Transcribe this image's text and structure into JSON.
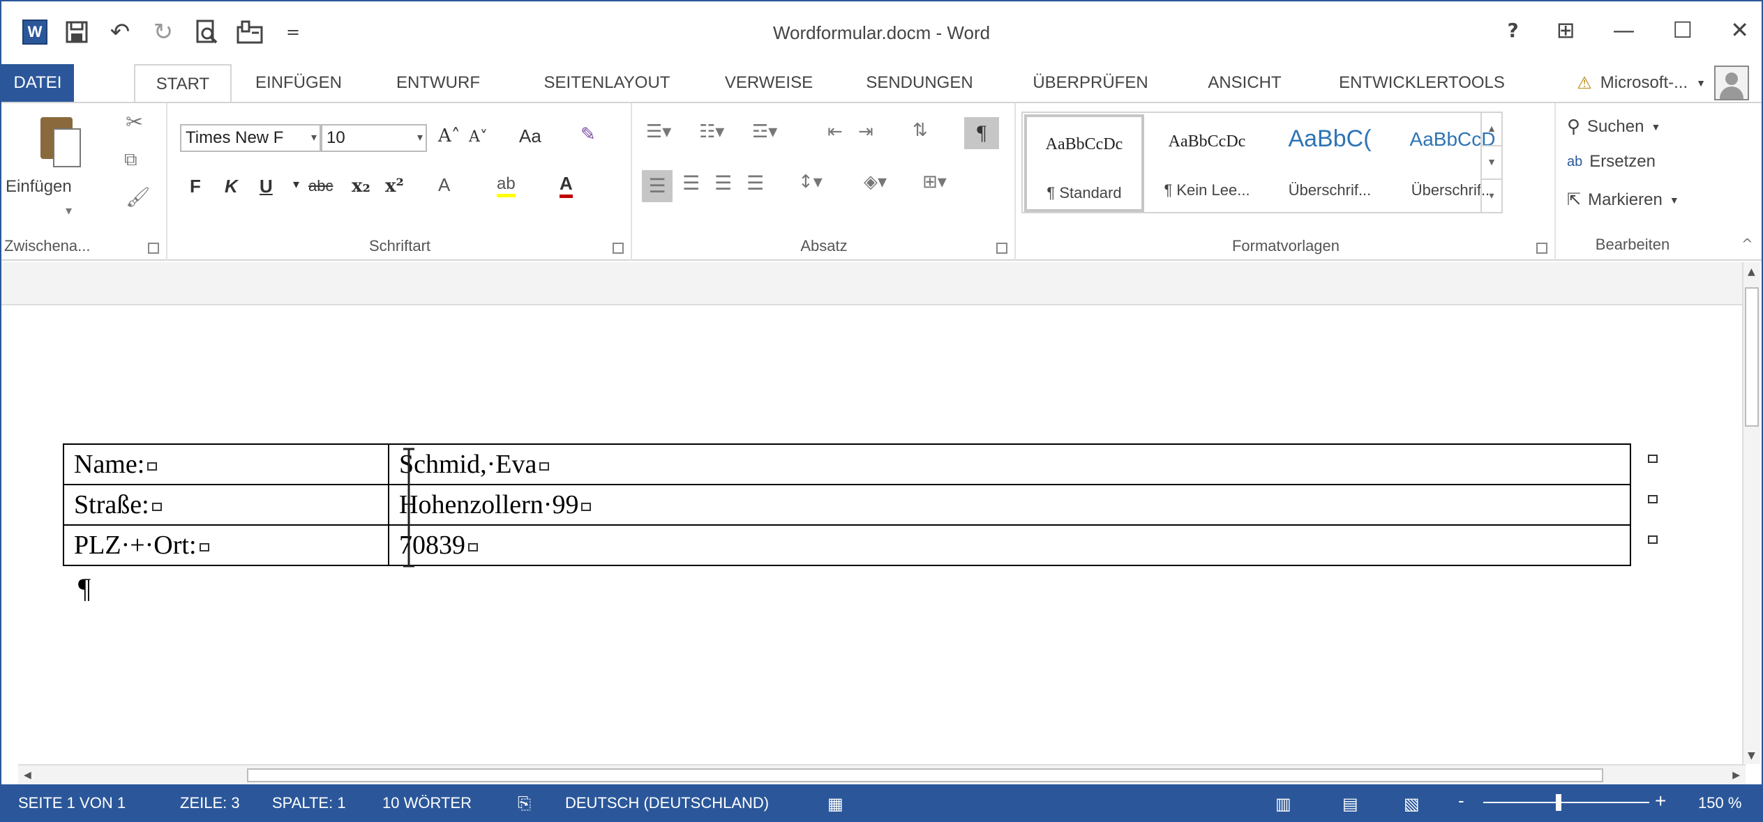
{
  "window": {
    "title": "Wordformular.docm - Word",
    "accent": "#2b579a"
  },
  "qat": {
    "word_icon": "W",
    "save_icon": "save-icon",
    "undo_icon": "undo-icon",
    "redo_icon": "redo-icon",
    "print_preview_icon": "print-preview-icon",
    "form_icon": "form-icon",
    "customize_icon": "customize-icon"
  },
  "window_buttons": {
    "help": "?",
    "ribbon_options": "⊞",
    "minimize": "—",
    "maximize": "☐",
    "close": "✕"
  },
  "tabs": [
    {
      "label": "DATEI"
    },
    {
      "label": "START"
    },
    {
      "label": "EINFÜGEN"
    },
    {
      "label": "ENTWURF"
    },
    {
      "label": "SEITENLAYOUT"
    },
    {
      "label": "VERWEISE"
    },
    {
      "label": "SENDUNGEN"
    },
    {
      "label": "ÜBERPRÜFEN"
    },
    {
      "label": "ANSICHT"
    },
    {
      "label": "ENTWICKLERTOOLS"
    }
  ],
  "account": {
    "name": "Microsoft-...",
    "warning_icon": "⚠"
  },
  "ribbon": {
    "clipboard": {
      "paste_label": "Einfügen",
      "group_label": "Zwischena..."
    },
    "font": {
      "font_name": "Times New F",
      "font_size": "10",
      "group_label": "Schriftart",
      "bold": "F",
      "italic": "K",
      "underline": "U",
      "strikethrough": "abc",
      "subscript": "x₂",
      "superscript": "x²",
      "grow": "A˄",
      "shrink": "A˅",
      "case": "Aa",
      "effects": "A",
      "highlight": "ab",
      "color": "A"
    },
    "paragraph": {
      "group_label": "Absatz",
      "show_marks": "¶"
    },
    "styles": {
      "group_label": "Formatvorlagen",
      "items": [
        {
          "sample": "AaBbCcDc",
          "name": "¶ Standard"
        },
        {
          "sample": "AaBbCcDc",
          "name": "¶ Kein Lee..."
        },
        {
          "sample": "AaBbC(",
          "name": "Überschrif..."
        },
        {
          "sample": "AaBbCcD",
          "name": "Überschrif..."
        }
      ]
    },
    "editing": {
      "group_label": "Bearbeiten",
      "find": "Suchen",
      "replace": "Ersetzen",
      "select": "Markieren"
    }
  },
  "document": {
    "rows": [
      {
        "label": "Name:",
        "value": "Schmid,·Eva"
      },
      {
        "label": "Straße:",
        "value": "Hohenzollern·99"
      },
      {
        "label": "PLZ·+·Ort:",
        "value": "70839"
      }
    ],
    "pilcrow": "¶"
  },
  "statusbar": {
    "page": "SEITE 1 VON 1",
    "line": "ZEILE: 3",
    "column": "SPALTE: 1",
    "words": "10 WÖRTER",
    "language": "DEUTSCH (DEUTSCHLAND)",
    "zoom": "150 %",
    "zoom_level_percent": 150
  }
}
